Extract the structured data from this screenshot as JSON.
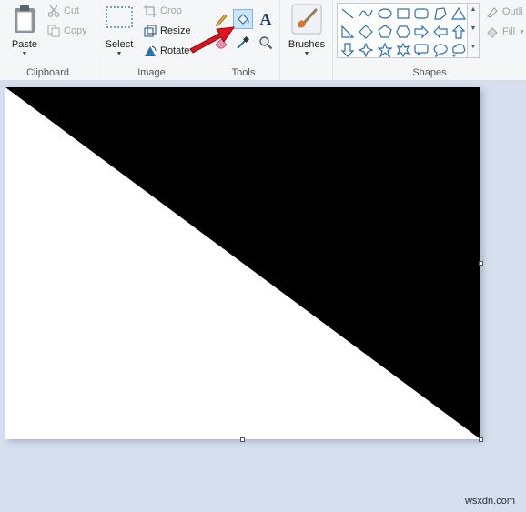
{
  "ribbon": {
    "clipboard": {
      "paste_label": "Paste",
      "cut_label": "Cut",
      "copy_label": "Copy",
      "group_label": "Clipboard"
    },
    "image": {
      "select_label": "Select",
      "crop_label": "Crop",
      "resize_label": "Resize",
      "rotate_label": "Rotate",
      "group_label": "Image"
    },
    "tools": {
      "group_label": "Tools",
      "items": [
        "pencil-icon",
        "fill-bucket-icon",
        "text-icon",
        "eraser-icon",
        "color-picker-icon",
        "magnifier-icon"
      ],
      "active_item": "fill-bucket-icon",
      "text_tool_glyph": "A"
    },
    "brushes": {
      "label": "Brushes"
    },
    "shapes": {
      "group_label": "Shapes",
      "outline_label": "Outli",
      "fill_label": "Fill",
      "gallery": [
        "line",
        "curve",
        "oval",
        "rectangle",
        "rounded-rectangle",
        "polygon",
        "triangle",
        "right-triangle",
        "diamond",
        "pentagon",
        "hexagon",
        "right-arrow",
        "left-arrow",
        "up-arrow",
        "down-arrow",
        "four-point-star",
        "five-point-star",
        "six-point-star",
        "rounded-callout",
        "oval-callout",
        "cloud-callout"
      ]
    }
  },
  "colors": {
    "accent": "#2b6fb5",
    "canvas_bg": "#ffffff",
    "fill_black": "#000000",
    "workspace": "#d5dfee",
    "annotation_arrow": "#e0141c"
  },
  "watermark": "wsxdn.com"
}
